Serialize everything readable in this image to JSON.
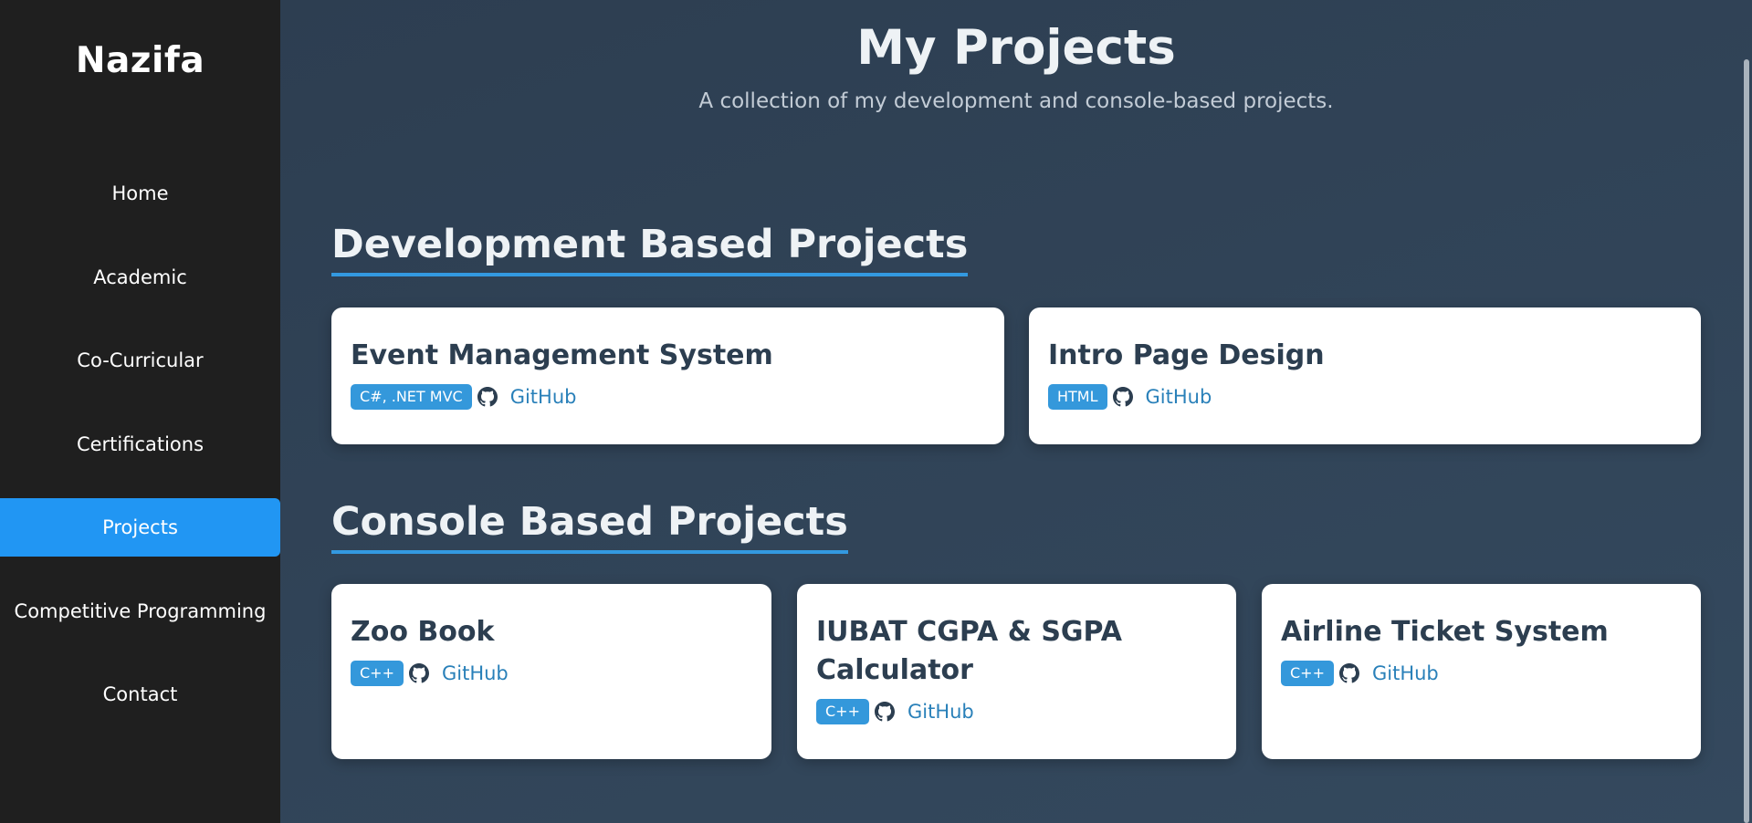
{
  "sidebar": {
    "brand": "Nazifa",
    "items": [
      {
        "label": "Home"
      },
      {
        "label": "Academic"
      },
      {
        "label": "Co-Curricular"
      },
      {
        "label": "Certifications"
      },
      {
        "label": "Projects",
        "active": true
      },
      {
        "label": "Competitive Programming"
      },
      {
        "label": "Contact"
      }
    ]
  },
  "header": {
    "title": "My Projects",
    "subtitle": "A collection of my development and console-based projects."
  },
  "sections": [
    {
      "title": "Development Based Projects",
      "projects": [
        {
          "title": "Event Management System",
          "tech": "C#, .NET MVC",
          "link": "GitHub"
        },
        {
          "title": "Intro Page Design",
          "tech": "HTML",
          "link": "GitHub"
        }
      ]
    },
    {
      "title": "Console Based Projects",
      "projects": [
        {
          "title": "Zoo Book",
          "tech": "C++",
          "link": "GitHub"
        },
        {
          "title": "IUBAT CGPA & SGPA Calculator",
          "tech": "C++",
          "link": "GitHub"
        },
        {
          "title": "Airline Ticket System",
          "tech": "C++",
          "link": "GitHub"
        }
      ]
    }
  ],
  "colors": {
    "sidebar_bg": "#1f1f1f",
    "active_nav": "#2196f3",
    "main_bg": "#2f4156",
    "accent": "#3498db",
    "link": "#2980b9"
  },
  "icons": {
    "repo": "github-icon"
  }
}
